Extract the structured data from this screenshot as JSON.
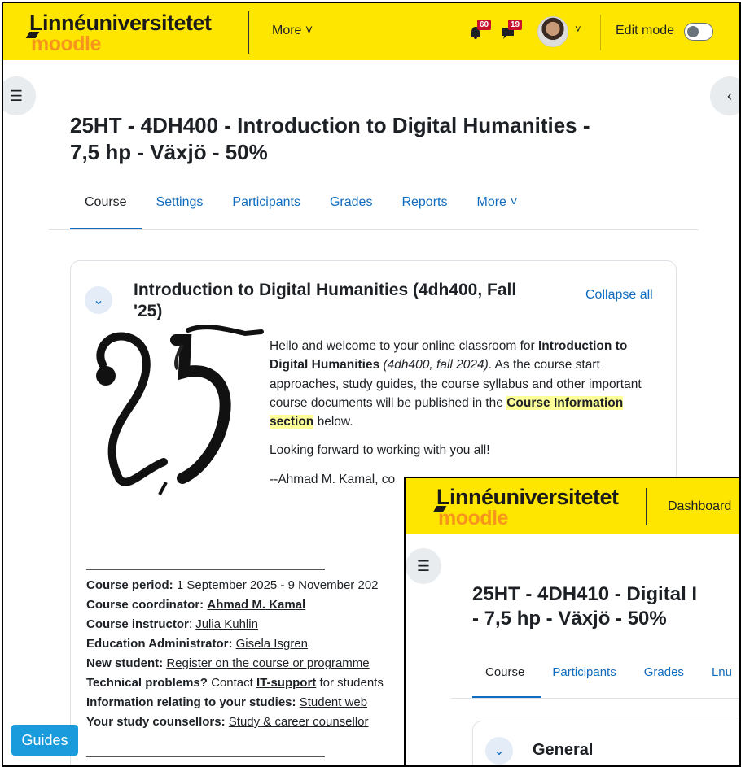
{
  "window1": {
    "logo": {
      "top": "Linnéuniversitetet",
      "bottom": "moodle"
    },
    "nav": {
      "more_label": "More ˅",
      "notifications_count": "60",
      "messages_count": "19",
      "user_menu_chevron": "˅",
      "edit_mode_label": "Edit mode"
    },
    "course": {
      "title_line1": "25HT - 4DH400 - Introduction to Digital Humanities -",
      "title_line2": "7,5 hp - Växjö - 50%"
    },
    "tabs": [
      "Course",
      "Settings",
      "Participants",
      "Grades",
      "Reports",
      "More ˅"
    ],
    "section": {
      "title_line1": "Introduction to Digital Humanities (4dh400, Fall",
      "title_line2": "'25)",
      "collapse_all": "Collapse all"
    },
    "welcome": {
      "p1_a": "Hello and welcome to your online classroom for ",
      "p1_bold": "Introduction to Digital Humanities",
      "p1_italic": " (4dh400, fall 2024)",
      "p1_b": ". As the course start approaches, study guides, the course syllabus and other important course documents will be published in the ",
      "p1_hl": "Course Information section",
      "p1_c": " below.",
      "p2": "Looking forward to working with you all!",
      "p3": "--Ahmad M. Kamal, co"
    },
    "info": {
      "period_label": "Course period:",
      "period_value": " 1 September 2025 - 9 November 202",
      "coordinator_label": "Course coordinator:",
      "coordinator_value": "Ahmad M. Kamal",
      "instructor_label": "Course instructor",
      "instructor_value": "Julia Kuhlin",
      "admin_label": "Education Administrator:",
      "admin_value": "Gisela Isgren",
      "newstudent_label": "New student:",
      "newstudent_value": "Register on the course or programme",
      "tech_label": "Technical problems?",
      "tech_text": " Contact ",
      "tech_link": "IT-support",
      "tech_tail": " for students",
      "studies_label": "Information relating to your studies:",
      "studies_value": "Student web",
      "counsellor_label": "Your study counsellors:",
      "counsellor_value": "Study & career counsellor"
    },
    "guides_label": "Guides"
  },
  "window2": {
    "logo": {
      "top": "Linnéuniversitetet",
      "bottom": "moodle"
    },
    "nav": {
      "dashboard_label": "Dashboard"
    },
    "course": {
      "title_line1": "25HT - 4DH410 - Digital I",
      "title_line2": "- 7,5 hp - Växjö - 50%"
    },
    "tabs": [
      "Course",
      "Participants",
      "Grades",
      "Lnu"
    ],
    "section": {
      "title": "General"
    }
  },
  "colors": {
    "brand_yellow": "#ffe600",
    "link_blue": "#0f6cbf",
    "moodle_orange": "#f7941d",
    "badge_red": "#c8102e",
    "guides_blue": "#1a9bdb"
  }
}
